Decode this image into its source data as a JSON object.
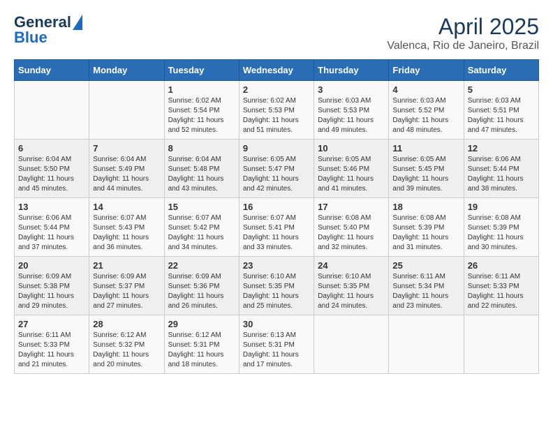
{
  "header": {
    "logo_line1": "General",
    "logo_line2": "Blue",
    "month": "April 2025",
    "location": "Valenca, Rio de Janeiro, Brazil"
  },
  "days_of_week": [
    "Sunday",
    "Monday",
    "Tuesday",
    "Wednesday",
    "Thursday",
    "Friday",
    "Saturday"
  ],
  "weeks": [
    [
      {
        "day": "",
        "sunrise": "",
        "sunset": "",
        "daylight": ""
      },
      {
        "day": "",
        "sunrise": "",
        "sunset": "",
        "daylight": ""
      },
      {
        "day": "1",
        "sunrise": "Sunrise: 6:02 AM",
        "sunset": "Sunset: 5:54 PM",
        "daylight": "Daylight: 11 hours and 52 minutes."
      },
      {
        "day": "2",
        "sunrise": "Sunrise: 6:02 AM",
        "sunset": "Sunset: 5:53 PM",
        "daylight": "Daylight: 11 hours and 51 minutes."
      },
      {
        "day": "3",
        "sunrise": "Sunrise: 6:03 AM",
        "sunset": "Sunset: 5:53 PM",
        "daylight": "Daylight: 11 hours and 49 minutes."
      },
      {
        "day": "4",
        "sunrise": "Sunrise: 6:03 AM",
        "sunset": "Sunset: 5:52 PM",
        "daylight": "Daylight: 11 hours and 48 minutes."
      },
      {
        "day": "5",
        "sunrise": "Sunrise: 6:03 AM",
        "sunset": "Sunset: 5:51 PM",
        "daylight": "Daylight: 11 hours and 47 minutes."
      }
    ],
    [
      {
        "day": "6",
        "sunrise": "Sunrise: 6:04 AM",
        "sunset": "Sunset: 5:50 PM",
        "daylight": "Daylight: 11 hours and 45 minutes."
      },
      {
        "day": "7",
        "sunrise": "Sunrise: 6:04 AM",
        "sunset": "Sunset: 5:49 PM",
        "daylight": "Daylight: 11 hours and 44 minutes."
      },
      {
        "day": "8",
        "sunrise": "Sunrise: 6:04 AM",
        "sunset": "Sunset: 5:48 PM",
        "daylight": "Daylight: 11 hours and 43 minutes."
      },
      {
        "day": "9",
        "sunrise": "Sunrise: 6:05 AM",
        "sunset": "Sunset: 5:47 PM",
        "daylight": "Daylight: 11 hours and 42 minutes."
      },
      {
        "day": "10",
        "sunrise": "Sunrise: 6:05 AM",
        "sunset": "Sunset: 5:46 PM",
        "daylight": "Daylight: 11 hours and 41 minutes."
      },
      {
        "day": "11",
        "sunrise": "Sunrise: 6:05 AM",
        "sunset": "Sunset: 5:45 PM",
        "daylight": "Daylight: 11 hours and 39 minutes."
      },
      {
        "day": "12",
        "sunrise": "Sunrise: 6:06 AM",
        "sunset": "Sunset: 5:44 PM",
        "daylight": "Daylight: 11 hours and 38 minutes."
      }
    ],
    [
      {
        "day": "13",
        "sunrise": "Sunrise: 6:06 AM",
        "sunset": "Sunset: 5:44 PM",
        "daylight": "Daylight: 11 hours and 37 minutes."
      },
      {
        "day": "14",
        "sunrise": "Sunrise: 6:07 AM",
        "sunset": "Sunset: 5:43 PM",
        "daylight": "Daylight: 11 hours and 36 minutes."
      },
      {
        "day": "15",
        "sunrise": "Sunrise: 6:07 AM",
        "sunset": "Sunset: 5:42 PM",
        "daylight": "Daylight: 11 hours and 34 minutes."
      },
      {
        "day": "16",
        "sunrise": "Sunrise: 6:07 AM",
        "sunset": "Sunset: 5:41 PM",
        "daylight": "Daylight: 11 hours and 33 minutes."
      },
      {
        "day": "17",
        "sunrise": "Sunrise: 6:08 AM",
        "sunset": "Sunset: 5:40 PM",
        "daylight": "Daylight: 11 hours and 32 minutes."
      },
      {
        "day": "18",
        "sunrise": "Sunrise: 6:08 AM",
        "sunset": "Sunset: 5:39 PM",
        "daylight": "Daylight: 11 hours and 31 minutes."
      },
      {
        "day": "19",
        "sunrise": "Sunrise: 6:08 AM",
        "sunset": "Sunset: 5:39 PM",
        "daylight": "Daylight: 11 hours and 30 minutes."
      }
    ],
    [
      {
        "day": "20",
        "sunrise": "Sunrise: 6:09 AM",
        "sunset": "Sunset: 5:38 PM",
        "daylight": "Daylight: 11 hours and 29 minutes."
      },
      {
        "day": "21",
        "sunrise": "Sunrise: 6:09 AM",
        "sunset": "Sunset: 5:37 PM",
        "daylight": "Daylight: 11 hours and 27 minutes."
      },
      {
        "day": "22",
        "sunrise": "Sunrise: 6:09 AM",
        "sunset": "Sunset: 5:36 PM",
        "daylight": "Daylight: 11 hours and 26 minutes."
      },
      {
        "day": "23",
        "sunrise": "Sunrise: 6:10 AM",
        "sunset": "Sunset: 5:35 PM",
        "daylight": "Daylight: 11 hours and 25 minutes."
      },
      {
        "day": "24",
        "sunrise": "Sunrise: 6:10 AM",
        "sunset": "Sunset: 5:35 PM",
        "daylight": "Daylight: 11 hours and 24 minutes."
      },
      {
        "day": "25",
        "sunrise": "Sunrise: 6:11 AM",
        "sunset": "Sunset: 5:34 PM",
        "daylight": "Daylight: 11 hours and 23 minutes."
      },
      {
        "day": "26",
        "sunrise": "Sunrise: 6:11 AM",
        "sunset": "Sunset: 5:33 PM",
        "daylight": "Daylight: 11 hours and 22 minutes."
      }
    ],
    [
      {
        "day": "27",
        "sunrise": "Sunrise: 6:11 AM",
        "sunset": "Sunset: 5:33 PM",
        "daylight": "Daylight: 11 hours and 21 minutes."
      },
      {
        "day": "28",
        "sunrise": "Sunrise: 6:12 AM",
        "sunset": "Sunset: 5:32 PM",
        "daylight": "Daylight: 11 hours and 20 minutes."
      },
      {
        "day": "29",
        "sunrise": "Sunrise: 6:12 AM",
        "sunset": "Sunset: 5:31 PM",
        "daylight": "Daylight: 11 hours and 18 minutes."
      },
      {
        "day": "30",
        "sunrise": "Sunrise: 6:13 AM",
        "sunset": "Sunset: 5:31 PM",
        "daylight": "Daylight: 11 hours and 17 minutes."
      },
      {
        "day": "",
        "sunrise": "",
        "sunset": "",
        "daylight": ""
      },
      {
        "day": "",
        "sunrise": "",
        "sunset": "",
        "daylight": ""
      },
      {
        "day": "",
        "sunrise": "",
        "sunset": "",
        "daylight": ""
      }
    ]
  ]
}
